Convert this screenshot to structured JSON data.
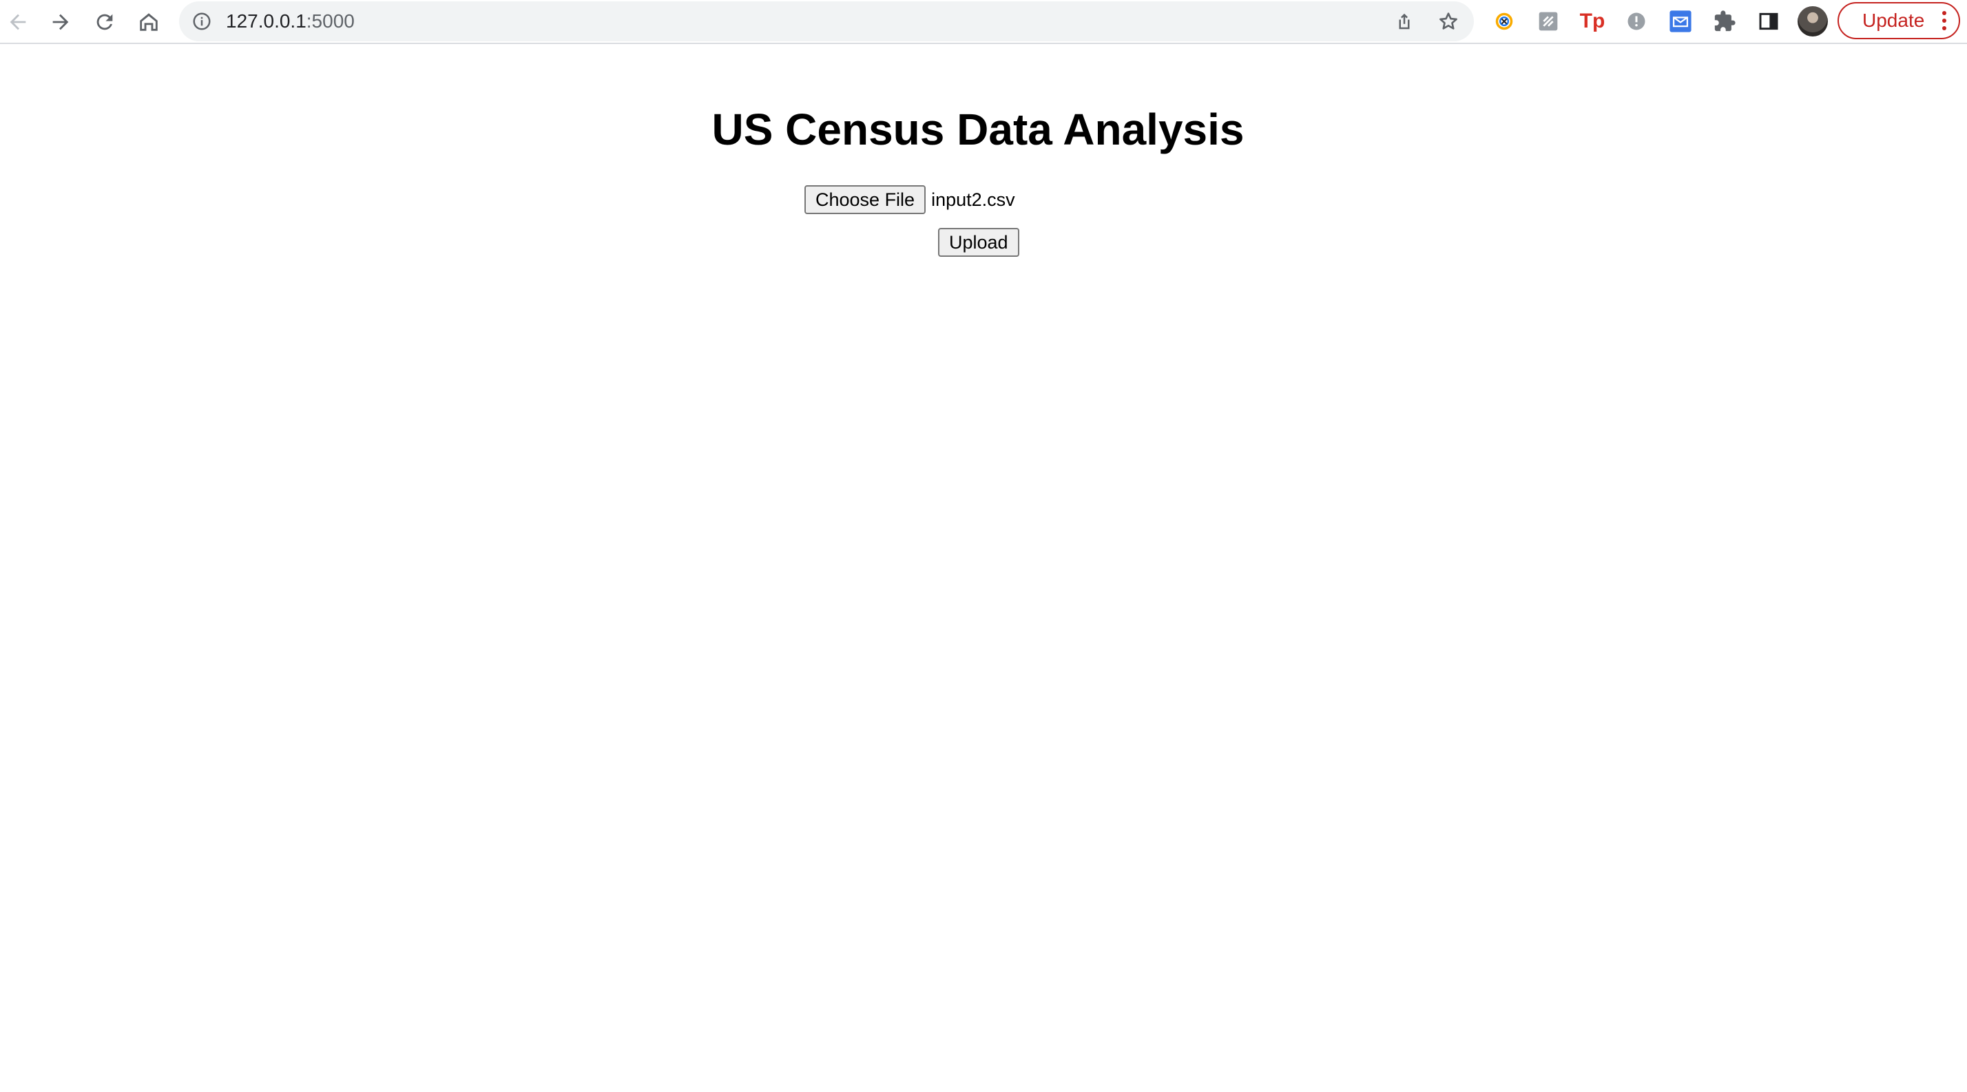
{
  "browser": {
    "url_host": "127.0.0.1",
    "url_port": ":5000",
    "update_label": "Update",
    "icons": {
      "back": "arrow-left-icon",
      "forward": "arrow-right-icon",
      "reload": "reload-icon",
      "home": "home-icon",
      "site_info": "info-icon",
      "share": "share-icon",
      "bookmark": "star-icon",
      "extensions": "puzzle-icon",
      "side_panel": "side-panel-icon",
      "menu": "kebab-menu-icon"
    },
    "extension_icons": [
      "extension-compass-icon",
      "extension-gray-tile-icon",
      "extension-tp-icon",
      "extension-gray-circle-icon",
      "extension-blue-mail-icon"
    ],
    "extension_tp_label": "Tp",
    "colors": {
      "update_accent": "#c5221f",
      "omnibox_bg": "#f1f3f4"
    }
  },
  "page": {
    "title": "US Census Data Analysis",
    "file_input": {
      "button_label": "Choose File",
      "selected_file": "input2.csv"
    },
    "upload_label": "Upload"
  }
}
